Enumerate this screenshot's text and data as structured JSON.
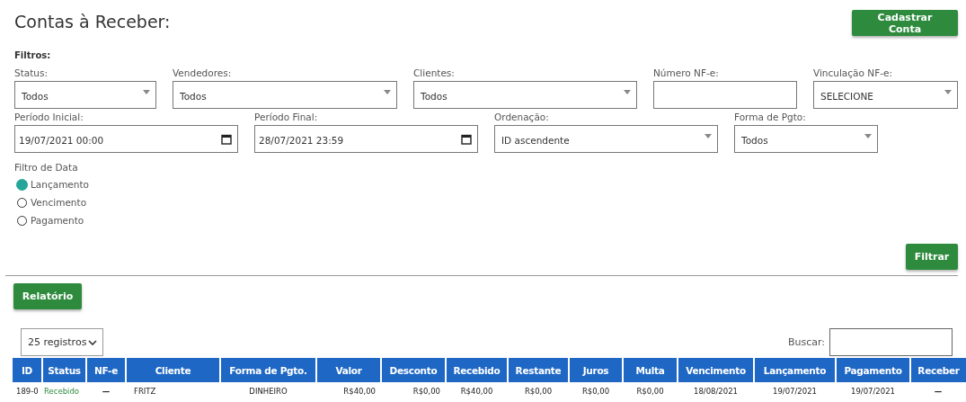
{
  "page_title": "Contas à Receber:",
  "add_button": "Cadastrar Conta",
  "filters_heading": "Filtros:",
  "filter_row_1": [
    {
      "kind": "select",
      "label": "Status:",
      "value": "Todos"
    },
    {
      "kind": "select",
      "label": "Vendedores:",
      "value": "Todos"
    },
    {
      "kind": "select",
      "label": "Clientes:",
      "value": "Todos"
    },
    {
      "kind": "text",
      "label": "Número NF-e:"
    },
    {
      "kind": "select",
      "label": "Vinculação NF-e:",
      "value": "SELECIONE"
    }
  ],
  "filter_row_2": [
    {
      "kind": "date",
      "label": "Período Inicial:",
      "value": "19/07/2021 00:00"
    },
    {
      "kind": "date",
      "label": "Período Final:",
      "value": "28/07/2021 23:59"
    },
    {
      "kind": "select",
      "label": "Ordenação:",
      "value": "ID ascendente"
    },
    {
      "kind": "select",
      "label": "Forma de Pgto:",
      "value": "Todos"
    }
  ],
  "date_filter": {
    "label": "Filtro de Data",
    "options": [
      {
        "label": "Lançamento",
        "selected": true
      },
      {
        "label": "Vencimento",
        "selected": false
      },
      {
        "label": "Pagamento",
        "selected": false
      }
    ]
  },
  "filter_button": "Filtrar",
  "report_button": "Relatório",
  "page_size": "25 registros",
  "search_label": "Buscar:",
  "table": {
    "columns": [
      "ID",
      "Status",
      "NF-e",
      "Cliente",
      "Forma de Pgto.",
      "Valor",
      "Desconto",
      "Recebido",
      "Restante",
      "Juros",
      "Multa",
      "Vencimento",
      "Lançamento",
      "Pagamento",
      "Receber"
    ],
    "rows": [
      [
        "189-0",
        "Recebido",
        "—",
        "FRITZ",
        "DINHEIRO",
        "R$40,00",
        "R$0,00",
        "R$40,00",
        "R$0,00",
        "R$0,00",
        "R$0,00",
        "18/08/2021",
        "19/07/2021",
        "19/07/2021",
        "—"
      ]
    ]
  }
}
